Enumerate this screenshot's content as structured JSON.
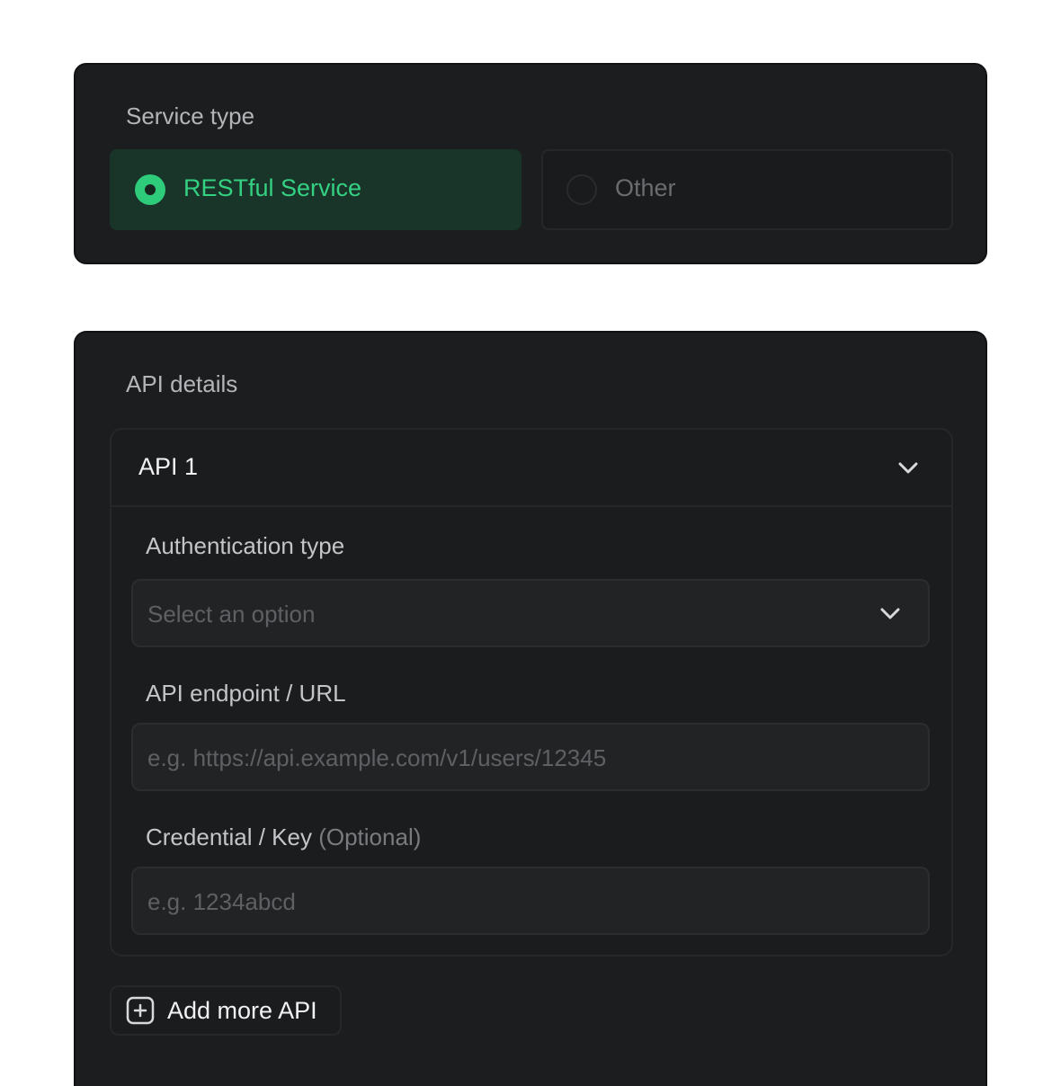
{
  "service_type": {
    "title": "Service type",
    "options": [
      {
        "label": "RESTful Service",
        "selected": true
      },
      {
        "label": "Other",
        "selected": false
      }
    ],
    "accent_color": "#2ecc7a"
  },
  "api_details": {
    "title": "API details",
    "apis": [
      {
        "title": "API 1",
        "expanded": true,
        "fields": {
          "auth": {
            "label": "Authentication type",
            "placeholder": "Select an option",
            "icon": "chevron-down-icon"
          },
          "url": {
            "label": "API endpoint / URL",
            "placeholder": "e.g. https://api.example.com/v1/users/12345"
          },
          "credential": {
            "label": "Credential / Key",
            "optional_tag": "(Optional)",
            "placeholder": "e.g. 1234abcd"
          }
        }
      }
    ],
    "add_button": {
      "label": "Add more API",
      "icon": "plus-square-icon"
    }
  }
}
